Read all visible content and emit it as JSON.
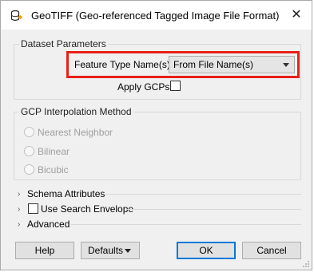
{
  "window": {
    "title": "GeoTIFF (Geo-referenced Tagged Image File Format) Para...",
    "close_icon": "close-icon",
    "app_icon": "database-import-icon"
  },
  "dataset": {
    "legend": "Dataset Parameters",
    "feature_type_label": "Feature Type Name(s):",
    "feature_type_value": "From File Name(s)",
    "apply_gcps_label": "Apply GCPs:",
    "apply_gcps_checked": false
  },
  "gcp": {
    "legend": "GCP Interpolation Method",
    "options": [
      "Nearest Neighbor",
      "Bilinear",
      "Bicubic"
    ]
  },
  "sections": {
    "schema_attributes": "Schema Attributes",
    "use_search_envelope": "Use Search Envelope",
    "advanced": "Advanced"
  },
  "buttons": {
    "help": "Help",
    "defaults": "Defaults",
    "ok": "OK",
    "cancel": "Cancel"
  },
  "colors": {
    "highlight": "#e8201a",
    "default_button_border": "#0078d7"
  }
}
